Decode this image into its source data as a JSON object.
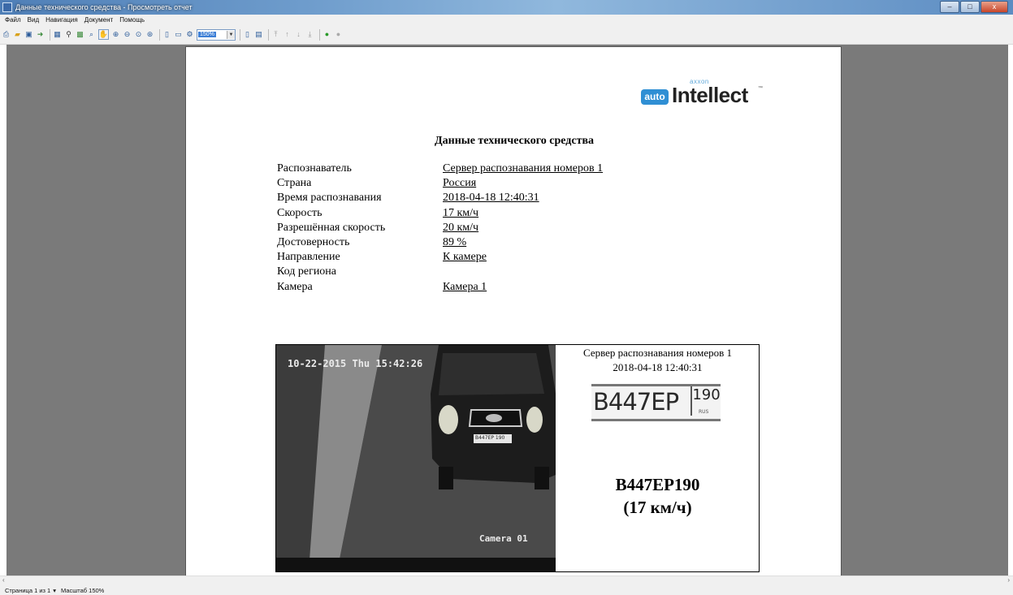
{
  "window": {
    "title": "Данные технического средства - Просмотреть отчет",
    "controls": {
      "minimize": "–",
      "maximize": "□",
      "close": "x"
    }
  },
  "menu": [
    "Файл",
    "Вид",
    "Навигация",
    "Документ",
    "Помощь"
  ],
  "toolbar": {
    "zoom_value": "150%",
    "icons": [
      "print-icon",
      "open-icon",
      "save-icon",
      "export-icon",
      "table-icon",
      "find-icon",
      "image-icon",
      "zoom-page-icon",
      "hand-icon",
      "zoom-in-icon",
      "zoom-out-icon",
      "zoom-width-icon",
      "zoom-fit-icon",
      "single-page-icon",
      "multi-page-icon",
      "page-setup-icon",
      "first-page-icon",
      "prev-page-icon",
      "next-page-icon",
      "last-page-icon",
      "refresh-icon",
      "stop-icon"
    ]
  },
  "report": {
    "logo": {
      "brand_small": "axxon",
      "badge": "auto",
      "product": "Intellect",
      "tm": "™"
    },
    "title": "Данные технического средства",
    "fields": [
      {
        "label": "Распознаватель",
        "value": "Сервер распознавания номеров 1"
      },
      {
        "label": "Страна",
        "value": "Россия"
      },
      {
        "label": "Время распознавания",
        "value": "2018-04-18 12:40:31"
      },
      {
        "label": "Скорость",
        "value": "17 км/ч"
      },
      {
        "label": "Разрешённая скорость",
        "value": "20 км/ч"
      },
      {
        "label": "Достоверность",
        "value": "89 %"
      },
      {
        "label": "Направление",
        "value": "К камере"
      },
      {
        "label": "Код региона",
        "value": ""
      },
      {
        "label": "Камера",
        "value": "Камера 1"
      }
    ],
    "camera_image": {
      "timestamp": "10-22-2015 Thu 15:42:26",
      "camera_label": "Camera 01",
      "plate_on_car": "B447EP 190"
    },
    "side_panel": {
      "server": "Сервер распознавания номеров 1",
      "datetime": "2018-04-18 12:40:31",
      "plate_image_main": "B447EP",
      "plate_image_region": "190",
      "plate_image_country": "RUS",
      "plate": "В447ЕР190",
      "speed": "(17 км/ч)"
    }
  },
  "statusbar": {
    "page": "Страница 1 из 1",
    "page_arrow": "▾",
    "scale": "Масштаб 150%"
  },
  "colors": {
    "viewer_bg": "#7a7a7a",
    "titlebar": "#5c8cc2",
    "logo_blue": "#2f8fd4"
  }
}
